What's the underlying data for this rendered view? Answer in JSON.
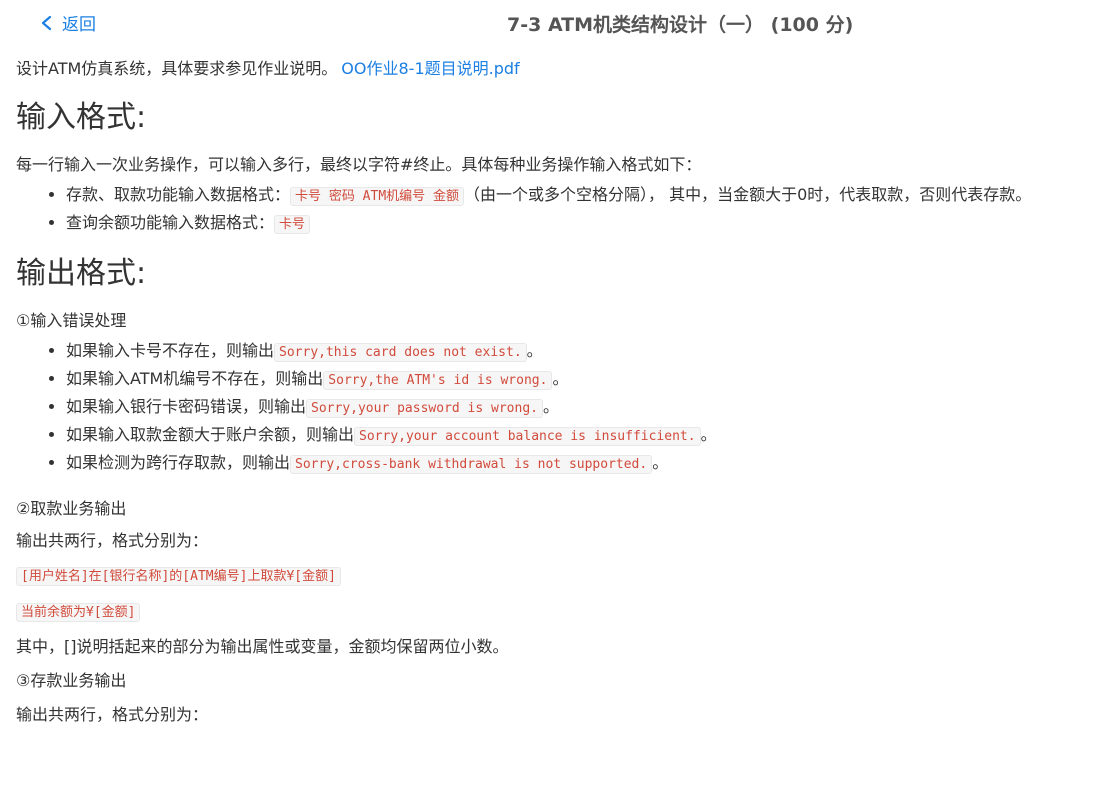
{
  "header": {
    "back_label": "返回",
    "title": "7-3 ATM机类结构设计（一） (100 分)"
  },
  "intro": {
    "text": "设计ATM仿真系统，具体要求参见作业说明。",
    "link": "OO作业8-1题目说明.pdf"
  },
  "input_format": {
    "heading": "输入格式:",
    "desc": "每一行输入一次业务操作，可以输入多行，最终以字符#终止。具体每种业务操作输入格式如下：",
    "items": [
      {
        "prefix": "存款、取款功能输入数据格式：",
        "code": "卡号 密码 ATM机编号 金额",
        "suffix": "（由一个或多个空格分隔），  其中，当金额大于0时，代表取款，否则代表存款。"
      },
      {
        "prefix": "查询余额功能输入数据格式：",
        "code": "卡号",
        "suffix": ""
      }
    ]
  },
  "output_format": {
    "heading": "输出格式:",
    "errors_title": "①输入错误处理",
    "errors": [
      {
        "prefix": "如果输入卡号不存在，则输出",
        "code": "Sorry,this card does not exist.",
        "suffix": "。"
      },
      {
        "prefix": "如果输入ATM机编号不存在，则输出",
        "code": "Sorry,the ATM's id is wrong.",
        "suffix": "。"
      },
      {
        "prefix": "如果输入银行卡密码错误，则输出",
        "code": "Sorry,your password is wrong.",
        "suffix": "。"
      },
      {
        "prefix": "如果输入取款金额大于账户余额，则输出",
        "code": "Sorry,your account balance is insufficient.",
        "suffix": "。"
      },
      {
        "prefix": "如果检测为跨行存取款，则输出",
        "code": "Sorry,cross-bank withdrawal is not supported.",
        "suffix": "。"
      }
    ],
    "withdraw_title": "②取款业务输出",
    "withdraw_desc": "输出共两行，格式分别为：",
    "withdraw_line1": "[用户姓名]在[银行名称]的[ATM编号]上取款¥[金额]",
    "withdraw_line2": "当前余额为¥[金额]",
    "note": "其中，[]说明括起来的部分为输出属性或变量，金额均保留两位小数。",
    "deposit_title": "③存款业务输出",
    "deposit_desc": "输出共两行，格式分别为："
  },
  "colors": {
    "link": "#1b7fe3",
    "code_text": "#d14b3c",
    "code_bg": "#f6f6f6"
  }
}
